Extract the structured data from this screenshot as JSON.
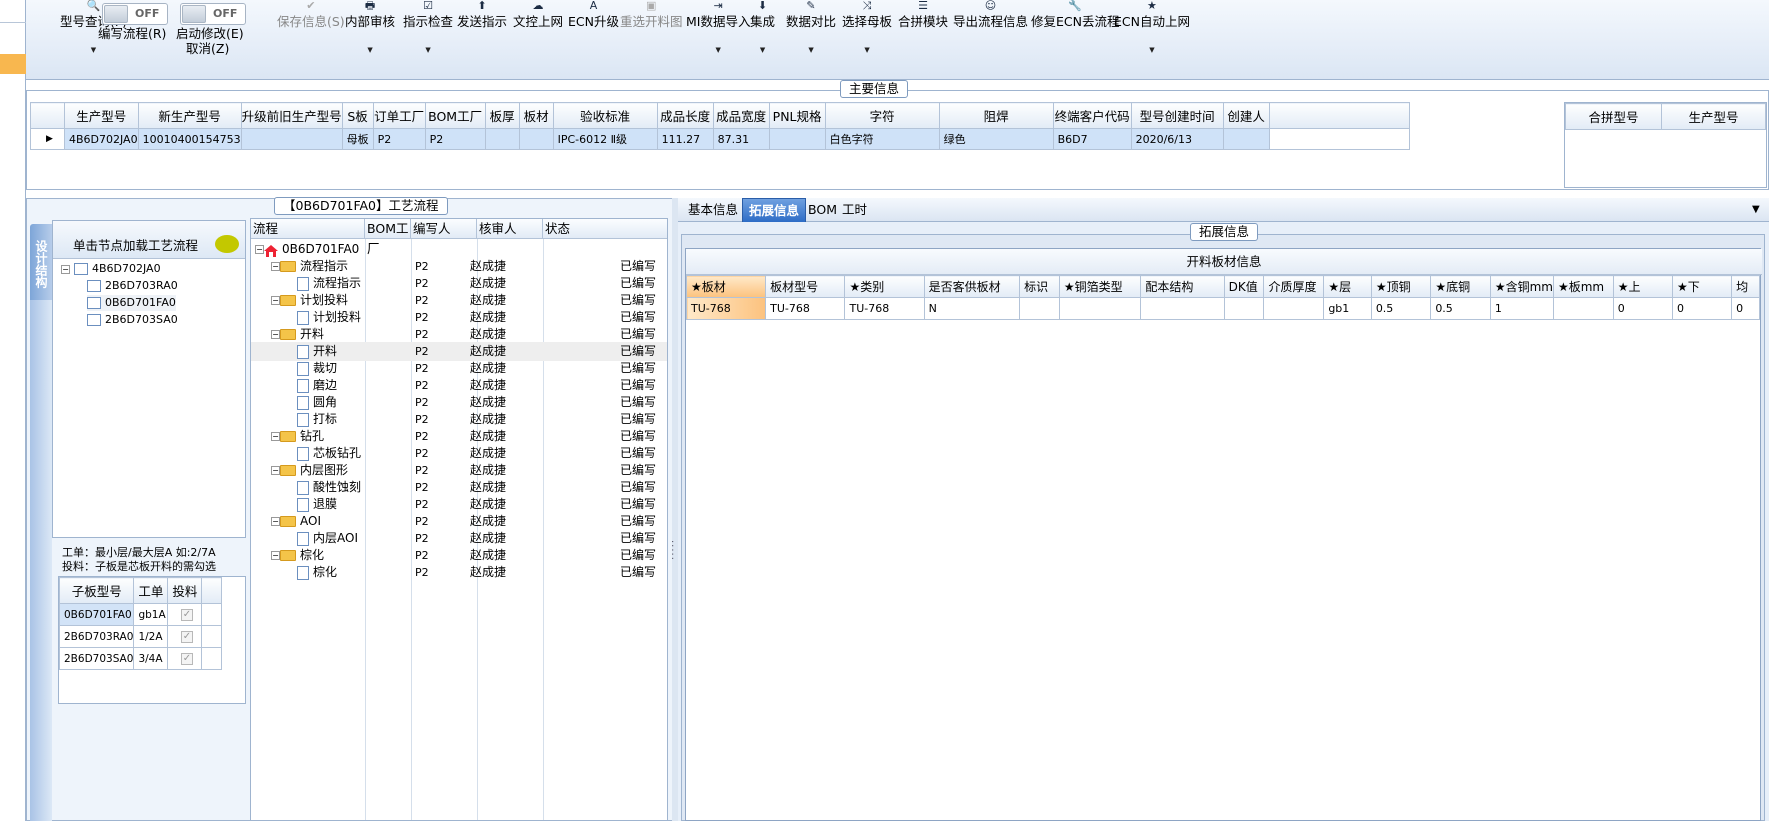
{
  "toolbar": {
    "items": [
      {
        "icon": "search-icon",
        "label": "型号查询(F)",
        "dropdown": true
      },
      {
        "icon": "save-icon",
        "label": "保存信息(S)",
        "disabled": true
      },
      {
        "icon": "print-icon",
        "label": "内部审核",
        "dropdown": true
      },
      {
        "icon": "check-icon",
        "label": "指示检查",
        "dropdown": true
      },
      {
        "icon": "upload-icon",
        "label": "发送指示"
      },
      {
        "icon": "cloud-icon",
        "label": "文控上网"
      },
      {
        "icon": "font-icon",
        "label": "ECN升级"
      },
      {
        "icon": "image-icon",
        "label": "重选开料图",
        "disabled": true
      },
      {
        "icon": "import-icon",
        "label": "MI数据导入",
        "dropdown": true
      },
      {
        "icon": "download-icon",
        "label": "集成",
        "dropdown": true
      },
      {
        "icon": "compare-icon",
        "label": "数据对比",
        "dropdown": true
      },
      {
        "icon": "shuffle-icon",
        "label": "选择母板",
        "dropdown": true
      },
      {
        "icon": "list-icon",
        "label": "合拼模块"
      },
      {
        "icon": "smiley-icon",
        "label": "导出流程信息"
      },
      {
        "icon": "wrench-icon",
        "label": "修复ECN丢流程"
      },
      {
        "icon": "star-icon",
        "label": "ECN自动上网",
        "dropdown": true
      }
    ],
    "toggles": [
      {
        "state": "OFF",
        "label": "编写流程(R)"
      },
      {
        "state": "OFF",
        "label": "启动修改(E)",
        "sublabel": "取消(Z)"
      }
    ]
  },
  "main_info": {
    "title": "主要信息",
    "columns": [
      "生产型号",
      "新生产型号",
      "升级前旧生产型号",
      "S板",
      "订单工厂",
      "BOM工厂",
      "板厚",
      "板材",
      "验收标准",
      "成品长度",
      "成品宽度",
      "PNL规格",
      "字符",
      "阻焊",
      "终端客户代码",
      "型号创建时间",
      "创建人"
    ],
    "row": [
      "4B6D702JA0",
      "10010400154753",
      "",
      "母板",
      "P2",
      "P2",
      "",
      "",
      "IPC-6012 Ⅱ级",
      "111.27",
      "87.31",
      "",
      "白色字符",
      "绿色",
      "B6D7",
      "2020/6/13",
      ""
    ],
    "merge_columns": [
      "合拼型号",
      "生产型号"
    ]
  },
  "process": {
    "title": "【0B6D701FA0】工艺流程",
    "side_tab": "设计结构",
    "tree_header": "单击节点加载工艺流程",
    "tree": [
      {
        "label": "4B6D702JA0",
        "level": 0
      },
      {
        "label": "2B6D703RA0",
        "level": 1
      },
      {
        "label": "0B6D701FA0",
        "level": 1,
        "selected": true
      },
      {
        "label": "2B6D703SA0",
        "level": 1
      }
    ],
    "info_line1": "工单：最小层/最大层A 如:2/7A",
    "info_line2": "投料：子板是芯板开料的需勾选",
    "sub_columns": [
      "子板型号",
      "工单",
      "投料"
    ],
    "sub_rows": [
      {
        "model": "0B6D701FA0",
        "order": "gb1A",
        "checked": true
      },
      {
        "model": "2B6D703RA0",
        "order": "1/2A",
        "checked": true
      },
      {
        "model": "2B6D703SA0",
        "order": "3/4A",
        "checked": true
      }
    ],
    "flow_columns": [
      "流程",
      "BOM工厂",
      "编写人",
      "核审人",
      "状态"
    ],
    "flow_rows": [
      {
        "name": "0B6D701FA0",
        "type": "root",
        "factory": "",
        "author": "",
        "status": ""
      },
      {
        "name": "流程指示",
        "type": "folder",
        "factory": "P2",
        "author": "赵成捷",
        "status": "已编写"
      },
      {
        "name": "流程指示",
        "type": "leaf",
        "factory": "P2",
        "author": "赵成捷",
        "status": "已编写"
      },
      {
        "name": "计划投料",
        "type": "folder",
        "factory": "P2",
        "author": "赵成捷",
        "status": "已编写"
      },
      {
        "name": "计划投料",
        "type": "leaf",
        "factory": "P2",
        "author": "赵成捷",
        "status": "已编写"
      },
      {
        "name": "开料",
        "type": "folder",
        "factory": "P2",
        "author": "赵成捷",
        "status": "已编写"
      },
      {
        "name": "开料",
        "type": "leaf",
        "factory": "P2",
        "author": "赵成捷",
        "status": "已编写",
        "selected": true
      },
      {
        "name": "裁切",
        "type": "leaf",
        "factory": "P2",
        "author": "赵成捷",
        "status": "已编写"
      },
      {
        "name": "磨边",
        "type": "leaf",
        "factory": "P2",
        "author": "赵成捷",
        "status": "已编写"
      },
      {
        "name": "圆角",
        "type": "leaf",
        "factory": "P2",
        "author": "赵成捷",
        "status": "已编写"
      },
      {
        "name": "打标",
        "type": "leaf",
        "factory": "P2",
        "author": "赵成捷",
        "status": "已编写"
      },
      {
        "name": "钻孔",
        "type": "folder",
        "factory": "P2",
        "author": "赵成捷",
        "status": "已编写"
      },
      {
        "name": "芯板钻孔",
        "type": "leaf",
        "factory": "P2",
        "author": "赵成捷",
        "status": "已编写"
      },
      {
        "name": "内层图形",
        "type": "folder",
        "factory": "P2",
        "author": "赵成捷",
        "status": "已编写"
      },
      {
        "name": "酸性蚀刻",
        "type": "leaf",
        "factory": "P2",
        "author": "赵成捷",
        "status": "已编写"
      },
      {
        "name": "退膜",
        "type": "leaf",
        "factory": "P2",
        "author": "赵成捷",
        "status": "已编写"
      },
      {
        "name": "AOI",
        "type": "folder",
        "factory": "P2",
        "author": "赵成捷",
        "status": "已编写"
      },
      {
        "name": "内层AOI",
        "type": "leaf",
        "factory": "P2",
        "author": "赵成捷",
        "status": "已编写"
      },
      {
        "name": "棕化",
        "type": "folder",
        "factory": "P2",
        "author": "赵成捷",
        "status": "已编写"
      },
      {
        "name": "棕化",
        "type": "leaf",
        "factory": "P2",
        "author": "赵成捷",
        "status": "已编写"
      }
    ]
  },
  "right": {
    "tabs": [
      {
        "label": "基本信息",
        "active": false
      },
      {
        "label": "拓展信息",
        "active": true
      },
      {
        "label": "BOM",
        "active": false
      },
      {
        "label": "工时",
        "active": false
      }
    ],
    "ext_title": "拓展信息",
    "material_title": "开料板材信息",
    "material_columns": [
      "★板材",
      "板材型号",
      "★类别",
      "是否客供板材",
      "标识",
      "★铜箔类型",
      "配本结构",
      "DK值",
      "介质厚度",
      "★层",
      "★顶铜",
      "★底铜",
      "★含铜mm",
      "★板mm",
      "★上",
      "★下",
      "均"
    ],
    "material_row": [
      "TU-768",
      "TU-768",
      "TU-768",
      "N",
      "",
      "",
      "",
      "",
      "",
      "gb1",
      "0.5",
      "0.5",
      "1",
      "",
      "0",
      "0",
      "0"
    ]
  },
  "colors": {
    "accent": "#2d6cc6",
    "selection": "#cfe2f8",
    "highlight": "#fcc27e",
    "folder": "#f4c449"
  }
}
